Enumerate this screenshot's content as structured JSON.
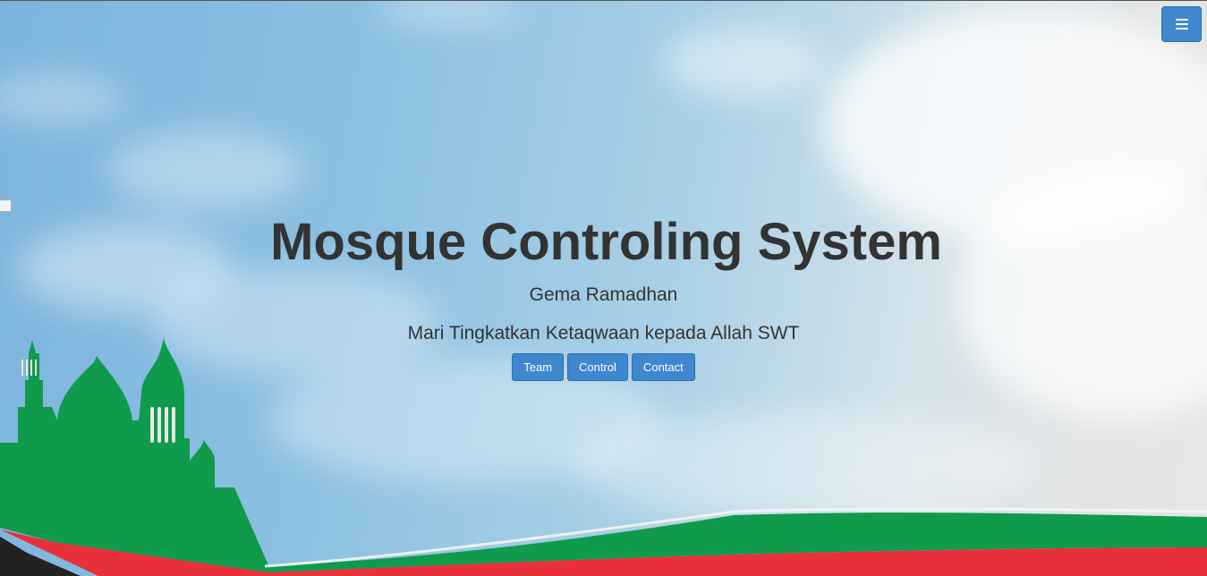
{
  "hero": {
    "title": "Mosque Controling System",
    "subtitle": "Gema Ramadhan",
    "tagline": "Mari Tingkatkan Ketaqwaan kepada Allah SWT"
  },
  "buttons": {
    "team": "Team",
    "control": "Control",
    "contact": "Contact"
  },
  "icons": {
    "menu": "hamburger-menu-icon",
    "broken_image": "broken-image-icon",
    "mosque": "mosque-silhouette"
  },
  "colors": {
    "accent": "#3f88d0",
    "title_text": "#333333",
    "mosque_green": "#0f9a4c",
    "ribbon_red": "#e8303a",
    "dark_band": "#222222"
  }
}
